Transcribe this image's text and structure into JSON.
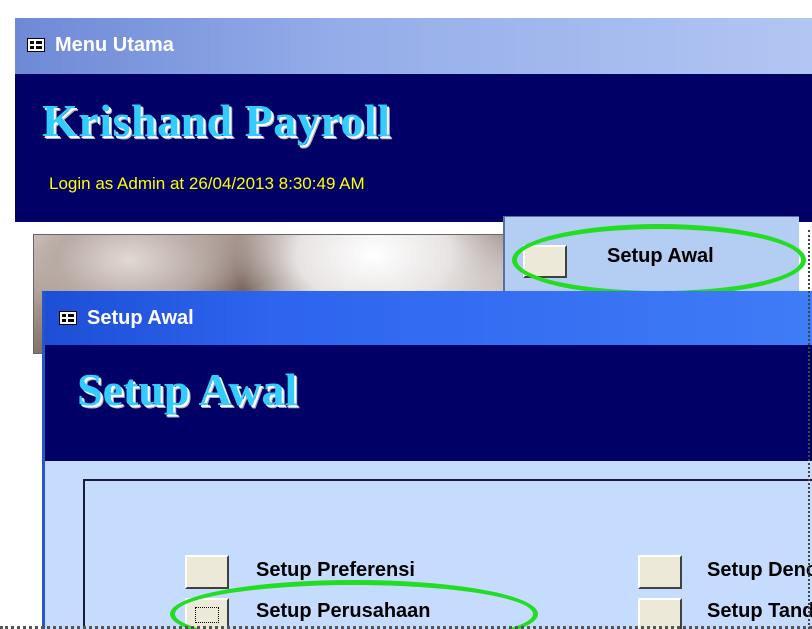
{
  "menu_window": {
    "title": "Menu Utama",
    "app_title": "Krishand Payroll",
    "login_info": "Login as Admin at 26/04/2013 8:30:49 AM",
    "setup_awal_button": {
      "label": "Setup Awal",
      "icon": "button"
    }
  },
  "setup_window": {
    "title": "Setup Awal",
    "heading": "Setup Awal",
    "options": [
      {
        "label": "Setup Preferensi"
      },
      {
        "label": "Setup Perusahaan",
        "focused": true
      },
      {
        "label": "Setup Deno"
      },
      {
        "label": "Setup Tand"
      }
    ]
  },
  "colors": {
    "header_bg": "#000066",
    "title_text": "#33ccff",
    "login_text": "#ffff00",
    "highlight_ring": "#22dd22",
    "active_titlebar": "#2e64ee",
    "inactive_titlebar": "#94ace8",
    "form_bg": "#c6dcff"
  },
  "icons": {
    "window_icon": "form-icon"
  }
}
